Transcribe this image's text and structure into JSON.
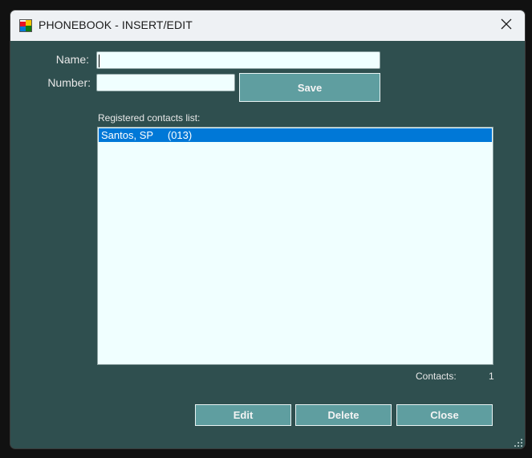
{
  "window": {
    "title": "PHONEBOOK - INSERT/EDIT"
  },
  "icons": {
    "app": "app-window-icon",
    "close": "close-icon",
    "grip": "resize-grip-icon"
  },
  "form": {
    "name_label": "Name:",
    "name_value": "",
    "number_label": "Number:",
    "number_value": "",
    "save_label": "Save"
  },
  "contacts": {
    "list_label": "Registered contacts list:",
    "items": [
      {
        "text": "Santos, SP     (013)",
        "selected": true
      }
    ],
    "count_label": "Contacts:",
    "count_value": "1"
  },
  "actions": {
    "edit_label": "Edit",
    "delete_label": "Delete",
    "close_label": "Close"
  },
  "colors": {
    "background": "#2f4f4f",
    "input_bg": "#f0ffff",
    "button_bg": "#5f9ea0",
    "selection": "#0078d7"
  }
}
